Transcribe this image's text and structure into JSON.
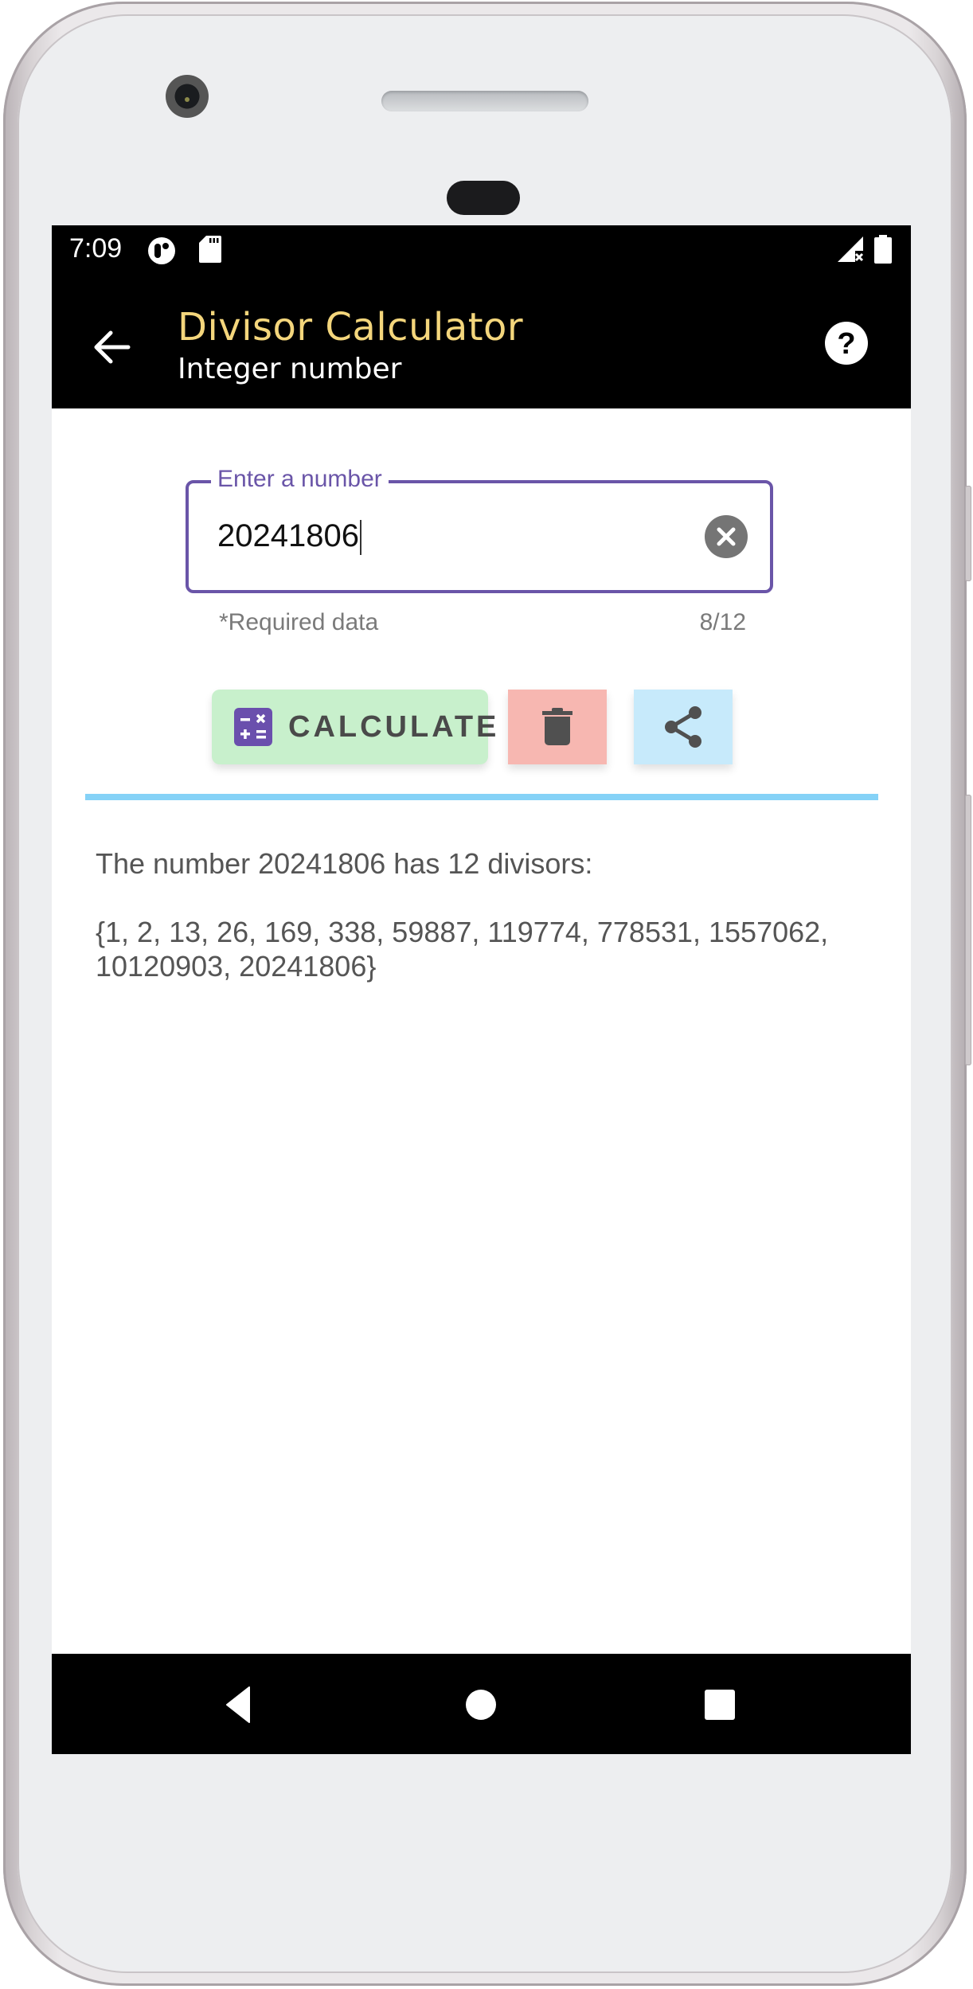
{
  "status_bar": {
    "time": "7:09",
    "left_icons": [
      "app-notification-icon",
      "sd-card-icon"
    ],
    "right_icons": [
      "signal-no-sim-icon",
      "battery-icon"
    ]
  },
  "app_bar": {
    "title": "Divisor Calculator",
    "subtitle": "Integer number",
    "back_icon": "arrow-back-icon",
    "help_icon": "help-circle-icon",
    "title_color": "#f4d67c"
  },
  "input": {
    "label": "Enter a number",
    "value": "20241806",
    "helper_text": "*Required data",
    "counter": "8/12",
    "clear_icon": "clear-circle-icon",
    "accent_color": "#6a55a8"
  },
  "actions": {
    "calculate_label": "CALCULATE",
    "calculate_icon": "calculator-icon",
    "calculate_color": "#c8f0cc",
    "delete_icon": "trash-icon",
    "delete_color": "#f7b7b1",
    "share_icon": "share-icon",
    "share_color": "#c7eafb"
  },
  "result": {
    "summary": "The number 20241806 has 12 divisors:",
    "divisors_line1": "{1, 2, 13, 26, 169, 338, 59887, 119774, 778531, 1557062,",
    "divisors_line2": "10120903, 20241806}",
    "divisors": [
      1,
      2,
      13,
      26,
      169,
      338,
      59887,
      119774,
      778531,
      1557062,
      10120903,
      20241806
    ]
  },
  "nav_bar": {
    "back_icon": "nav-back-icon",
    "home_icon": "nav-home-icon",
    "recents_icon": "nav-recents-icon"
  }
}
